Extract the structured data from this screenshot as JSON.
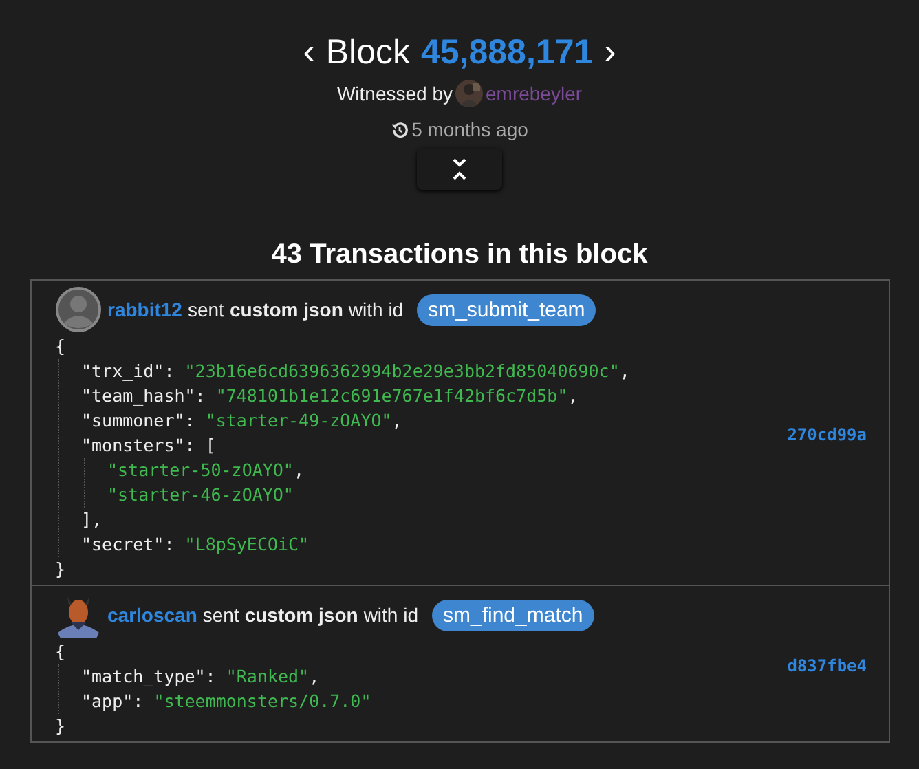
{
  "header": {
    "prev": "‹",
    "label": "Block",
    "number": "45,888,171",
    "next": "›",
    "witnessed_label": "Witnessed by",
    "witness": "emrebeyler",
    "time": "5 months ago"
  },
  "title": "43 Transactions in this block",
  "transactions": [
    {
      "user": "rabbit12",
      "avatar": {
        "kind": "default"
      },
      "verb": "sent",
      "op": "custom json",
      "with": "with id",
      "id": "sm_submit_team",
      "open": "{",
      "close": "}",
      "hash": "270cd99a",
      "entries": [
        {
          "key": "\"trx_id\":",
          "value": "\"23b16e6cd6396362994b2e29e3bb2fd85040690c\"",
          "comma": ","
        },
        {
          "key": "\"team_hash\":",
          "value": "\"748101b1e12c691e767e1f42bf6c7d5b\"",
          "comma": ","
        },
        {
          "key": "\"summoner\":",
          "value": "\"starter-49-zOAYO\"",
          "comma": ","
        },
        {
          "key": "\"monsters\":",
          "open": "[",
          "close": "]",
          "comma": ",",
          "children": [
            {
              "value": "\"starter-50-zOAYO\"",
              "comma": ","
            },
            {
              "value": "\"starter-46-zOAYO\""
            }
          ]
        },
        {
          "key": "\"secret\":",
          "value": "\"L8pSyECOiC\""
        }
      ]
    },
    {
      "user": "carloscan",
      "verb": "sent",
      "op": "custom json",
      "with": "with id",
      "id": "sm_find_match",
      "open": "{",
      "close": "}",
      "hash": "d837fbe4",
      "entries": [
        {
          "key": "\"match_type\":",
          "value": "\"Ranked\"",
          "comma": ","
        },
        {
          "key": "\"app\":",
          "value": "\"steemmonsters/0.7.0\""
        }
      ]
    }
  ]
}
